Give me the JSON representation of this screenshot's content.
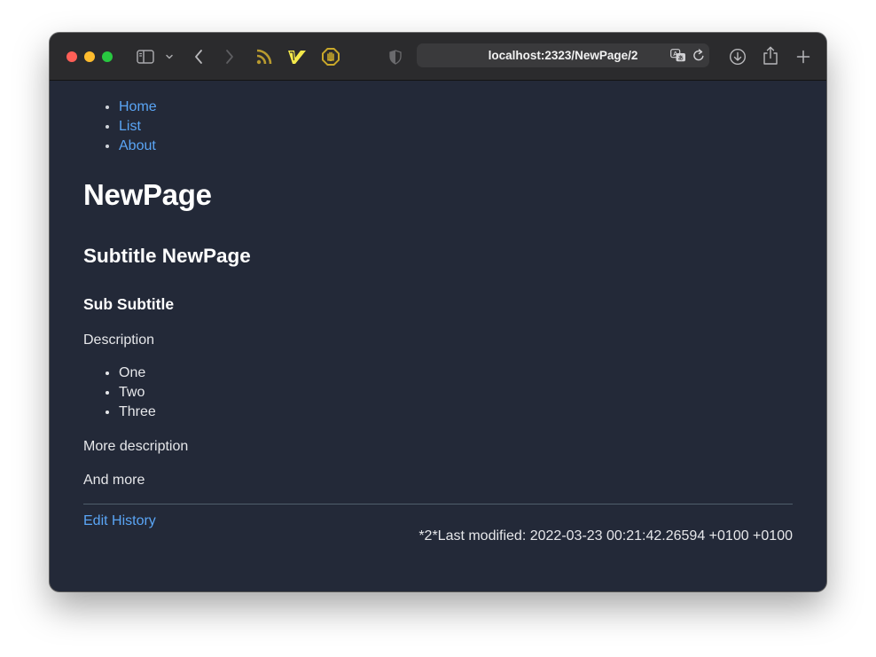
{
  "browser": {
    "url": "localhost:2323/NewPage/2"
  },
  "nav": {
    "items": [
      {
        "label": "Home"
      },
      {
        "label": "List"
      },
      {
        "label": "About"
      }
    ]
  },
  "page": {
    "title": "NewPage",
    "subtitle": "Subtitle NewPage",
    "sub_subtitle": "Sub Subtitle",
    "description": "Description",
    "list": [
      "One",
      "Two",
      "Three"
    ],
    "more_description": "More description",
    "and_more": "And more"
  },
  "footer": {
    "edit_history": "Edit History",
    "last_modified": "*2*Last modified: 2022-03-23 00:21:42.26594 +0100 +0100"
  },
  "colors": {
    "background": "#232938",
    "toolbar": "#2b2b2d",
    "link": "#5aa5f5",
    "rss_icon": "#b89a2f",
    "vim_icon": "#f4e94a",
    "hand_icon": "#c9a82a"
  }
}
